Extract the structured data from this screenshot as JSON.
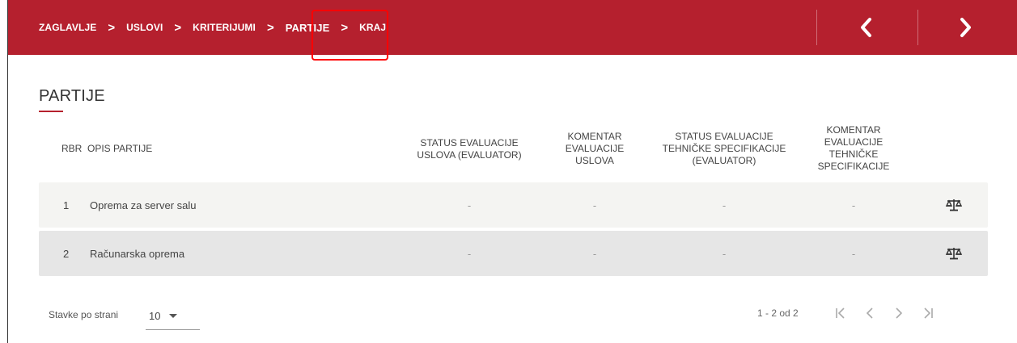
{
  "breadcrumb": {
    "items": [
      {
        "label": "ZAGLAVLJE"
      },
      {
        "label": "USLOVI"
      },
      {
        "label": "KRITERIJUMI"
      },
      {
        "label": "PARTIJE"
      },
      {
        "label": "KRAJ"
      }
    ],
    "separator": ">",
    "active_index": 3
  },
  "page": {
    "title": "PARTIJE"
  },
  "table": {
    "headers": {
      "rbr": "RBR",
      "opis": "OPIS PARTIJE",
      "status_uslova_l1": "STATUS EVALUACIJE",
      "status_uslova_l2": "USLOVA (EVALUATOR)",
      "komentar_uslova_l1": "KOMENTAR",
      "komentar_uslova_l2": "EVALUACIJE",
      "komentar_uslova_l3": "USLOVA",
      "status_teh_l1": "STATUS EVALUACIJE",
      "status_teh_l2": "TEHNIČKE SPECIFIKACIJE",
      "status_teh_l3": "(EVALUATOR)",
      "komentar_teh_l1": "KOMENTAR",
      "komentar_teh_l2": "EVALUACIJE",
      "komentar_teh_l3": "TEHNIČKE",
      "komentar_teh_l4": "SPECIFIKACIJE"
    },
    "rows": [
      {
        "rbr": "1",
        "opis": "Oprema za server salu",
        "status_uslova": "-",
        "komentar_uslova": "-",
        "status_teh": "-",
        "komentar_teh": "-",
        "action_icon": "scale-icon"
      },
      {
        "rbr": "2",
        "opis": "Računarska oprema",
        "status_uslova": "-",
        "komentar_uslova": "-",
        "status_teh": "-",
        "komentar_teh": "-",
        "action_icon": "scale-icon"
      }
    ]
  },
  "pagination": {
    "per_page_label": "Stavke po strani",
    "per_page_value": "10",
    "range": "1 - 2 od 2"
  },
  "colors": {
    "brand": "#b5202e",
    "row_odd": "#f4f4f2",
    "row_even": "#e6e6e6",
    "highlight": "#ff0000"
  }
}
